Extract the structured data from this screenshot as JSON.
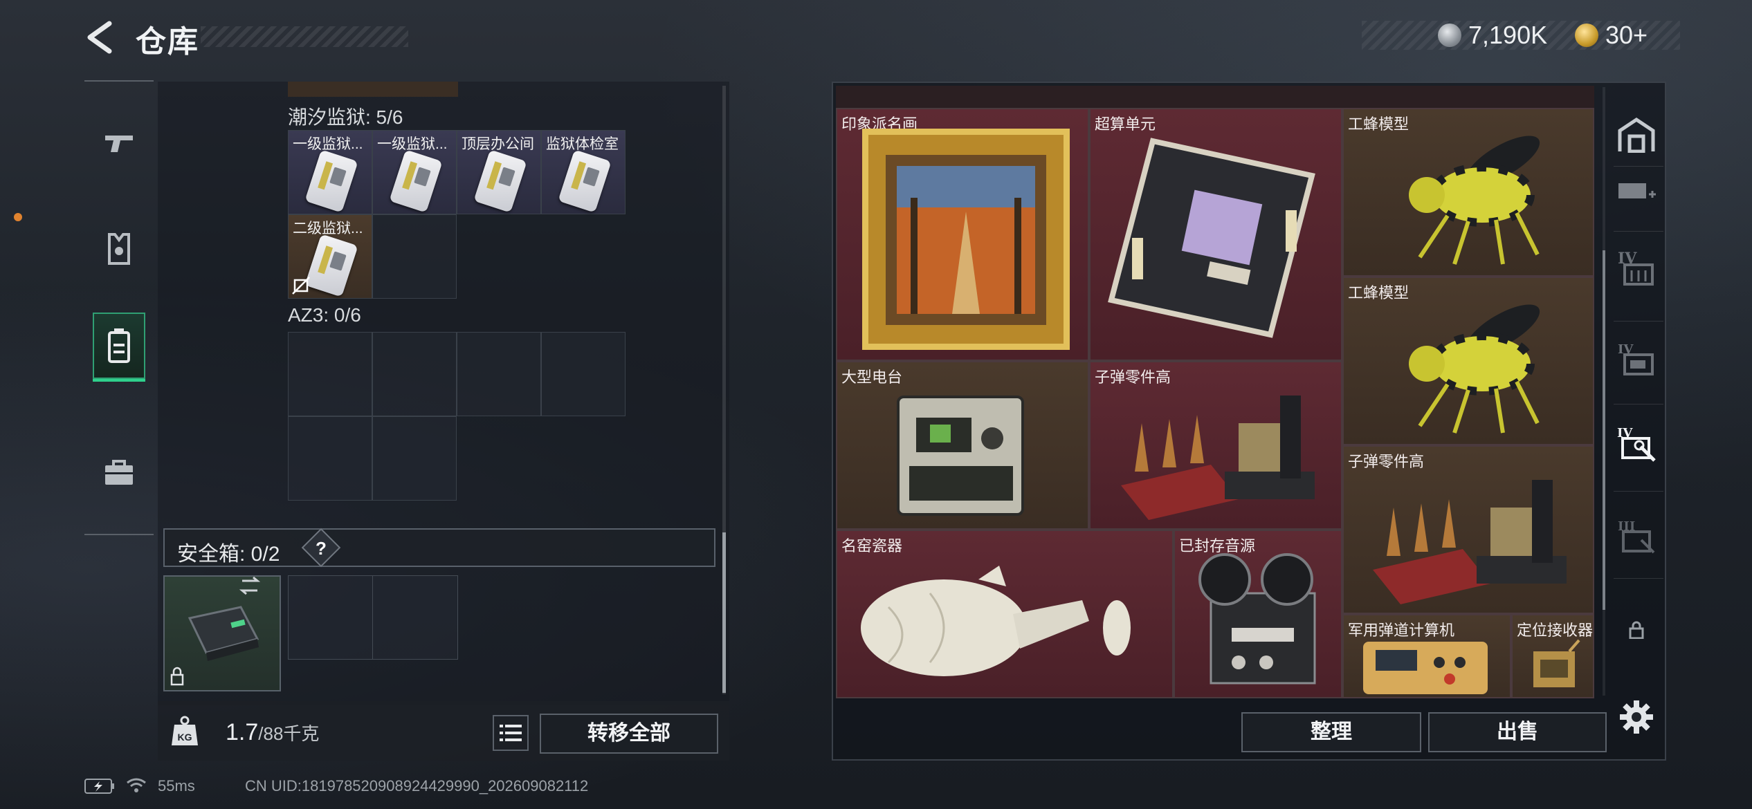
{
  "header": {
    "title": "仓库",
    "currencies": [
      {
        "icon": "silver-coin-icon",
        "value": "7,190K"
      },
      {
        "icon": "gold-coin-icon",
        "value": "30+"
      }
    ]
  },
  "left_sidebar": {
    "tabs": [
      {
        "icon": "gun-icon",
        "active": false
      },
      {
        "icon": "armor-vest-icon",
        "active": false
      },
      {
        "icon": "key-container-icon",
        "active": true
      },
      {
        "icon": "briefcase-icon",
        "active": false
      }
    ]
  },
  "key_containers": {
    "groups": [
      {
        "label": "潮汐监狱: 5/6",
        "items": [
          "一级监狱...",
          "一级监狱...",
          "顶层办公间",
          "监狱体检室",
          "二级监狱..."
        ]
      },
      {
        "label": "AZ3: 0/6",
        "items": []
      }
    ]
  },
  "safe_box": {
    "label": "安全箱: 0/2",
    "help": "?"
  },
  "footer": {
    "weight_current": "1.7",
    "weight_max": "/88千克",
    "transfer_all": "转移全部"
  },
  "storage": {
    "items": [
      {
        "name": "印象派名画",
        "bg": "#5e2a33"
      },
      {
        "name": "超算单元",
        "bg": "#5e2a33"
      },
      {
        "name": "工蜂模型",
        "bg": "#4a3a2c"
      },
      {
        "name": "工蜂模型",
        "bg": "#4a3a2c"
      },
      {
        "name": "大型电台",
        "bg": "#4a3a2c"
      },
      {
        "name": "子弹零件高",
        "bg": "#5e2a33"
      },
      {
        "name": "子弹零件高",
        "bg": "#4a3a2c"
      },
      {
        "name": "名窑瓷器",
        "bg": "#5e2a33"
      },
      {
        "name": "已封存音源",
        "bg": "#5e2a33"
      },
      {
        "name": "军用弹道计算机",
        "bg": "#4a3a2c"
      },
      {
        "name": "定位接收器",
        "bg": "#4a3a2c"
      }
    ],
    "tidy": "整理",
    "sell": "出售"
  },
  "right_sidebar": {
    "items": [
      {
        "icon": "warehouse-icon"
      },
      {
        "icon": "expansion-case-add-icon"
      },
      {
        "icon": "tier-iv-case-icon",
        "tier": "IV"
      },
      {
        "icon": "tier-iv-case-icon",
        "tier": "IV"
      },
      {
        "icon": "tier-iv-case-tool-icon",
        "tier": "IV"
      },
      {
        "icon": "tier-iii-case-icon",
        "tier": "III"
      },
      {
        "icon": "lock-icon"
      },
      {
        "icon": "gear-icon"
      }
    ]
  },
  "status_bar": {
    "ping": "55ms",
    "uid": "CN UID:1819785209089244299​90_202609082112"
  }
}
